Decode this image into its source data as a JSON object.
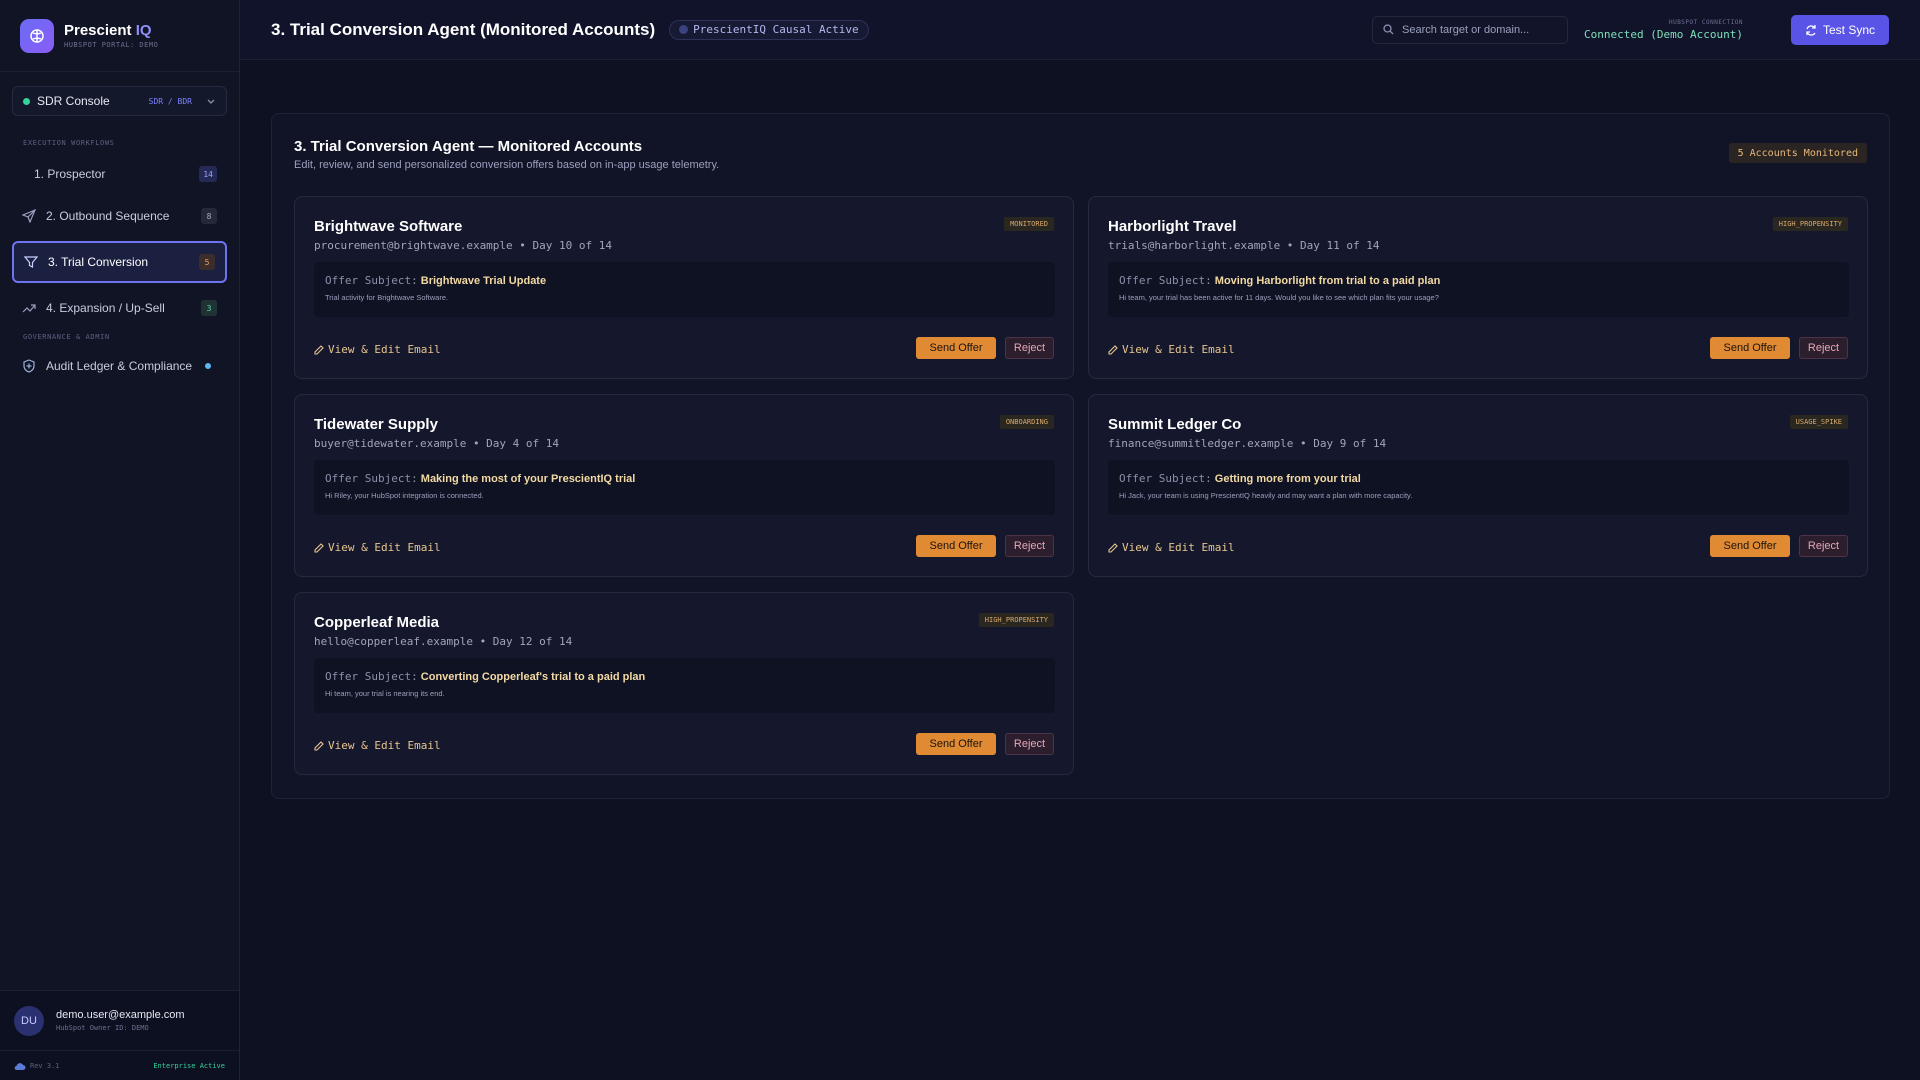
{
  "app": {
    "brand_name": "Prescient",
    "brand_suffix": "IQ",
    "portal": "HUBSPOT PORTAL: DEMO"
  },
  "console": {
    "label": "SDR Console",
    "role": "SDR / BDR"
  },
  "sidebar": {
    "section_workflows": "EXECUTION WORKFLOWS",
    "section_governance": "GOVERNANCE & ADMIN",
    "items": [
      {
        "label": "1. Prospector",
        "count": "14",
        "icon": "none"
      },
      {
        "label": "2. Outbound Sequence",
        "count": "8",
        "icon": "send-icon"
      },
      {
        "label": "3. Trial Conversion",
        "count": "5",
        "icon": "filter-icon",
        "active": true
      },
      {
        "label": "4. Expansion / Up-Sell",
        "count": "3",
        "icon": "trending-up-icon"
      }
    ],
    "audit": {
      "label": "Audit Ledger & Compliance",
      "icon": "shield-icon"
    }
  },
  "user": {
    "initials": "DU",
    "email": "demo.user@example.com",
    "owner": "HubSpot Owner ID: DEMO",
    "rev": "Rev 3.1",
    "plan": "Enterprise Active"
  },
  "topbar": {
    "title": "3. Trial Conversion Agent (Monitored Accounts)",
    "causal_badge": "PrescientIQ Causal Active",
    "search_placeholder": "Search target or domain...",
    "hub_label": "HUBSPOT CONNECTION",
    "hub_status": "Connected (Demo Account)",
    "sync_label": "Test Sync"
  },
  "panel": {
    "title": "3. Trial Conversion Agent — Monitored Accounts",
    "description": "Edit, review, and send personalized conversion offers based on in-app usage telemetry.",
    "monitored": "5 Accounts Monitored"
  },
  "labels": {
    "offer_subject": "Offer Subject:",
    "view_edit": "View & Edit Email",
    "send": "Send Offer",
    "reject": "Reject"
  },
  "accounts": [
    {
      "name": "Brightwave Software",
      "meta": "procurement@brightwave.example • Day 10 of 14",
      "tag": "MONITORED",
      "subject": "Brightwave Trial Update",
      "body": "Trial activity for Brightwave Software."
    },
    {
      "name": "Harborlight Travel",
      "meta": "trials@harborlight.example • Day 11 of 14",
      "tag": "HIGH_PROPENSITY",
      "subject": "Moving Harborlight from trial to a paid plan",
      "body": "Hi team, your trial has been active for 11 days. Would you like to see which plan fits your usage?"
    },
    {
      "name": "Tidewater Supply",
      "meta": "buyer@tidewater.example • Day 4 of 14",
      "tag": "ONBOARDING",
      "subject": "Making the most of your PrescientIQ trial",
      "body": "Hi Riley, your HubSpot integration is connected."
    },
    {
      "name": "Summit Ledger Co",
      "meta": "finance@summitledger.example • Day 9 of 14",
      "tag": "USAGE_SPIKE",
      "subject": "Getting more from your trial",
      "body": "Hi Jack, your team is using PrescientIQ heavily and may want a plan with more capacity."
    },
    {
      "name": "Copperleaf Media",
      "meta": "hello@copperleaf.example • Day 12 of 14",
      "tag": "HIGH_PROPENSITY",
      "subject": "Converting Copperleaf's trial to a paid plan",
      "body": "Hi team, your trial is nearing its end."
    }
  ]
}
